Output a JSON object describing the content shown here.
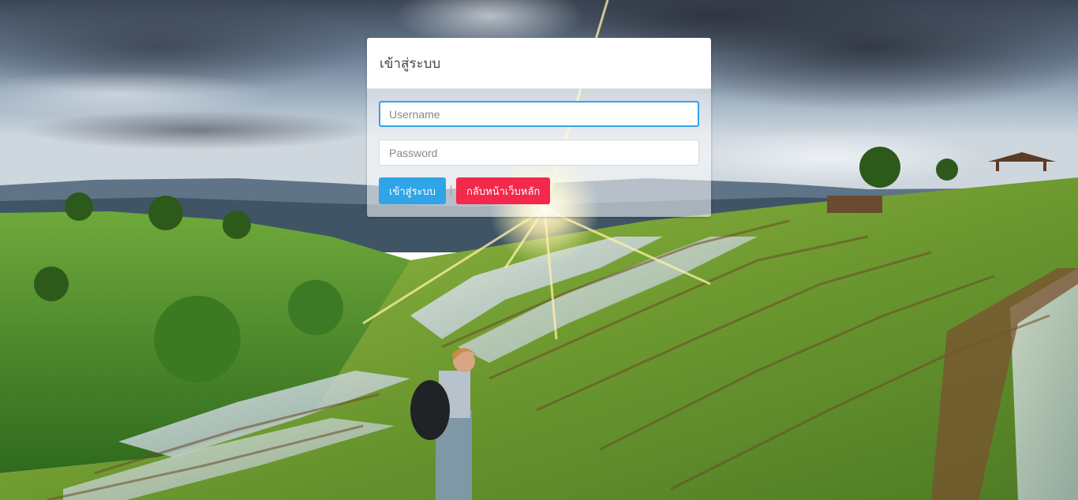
{
  "login": {
    "title": "เข้าสู่ระบบ",
    "username_placeholder": "Username",
    "password_placeholder": "Password",
    "login_button": "เข้าสู่ระบบ",
    "home_button": "กลับหน้าเว็บหลัก"
  },
  "colors": {
    "login_button": "#2fa4e7",
    "home_button": "#f2294a",
    "focus_border": "#3aa0e8"
  }
}
